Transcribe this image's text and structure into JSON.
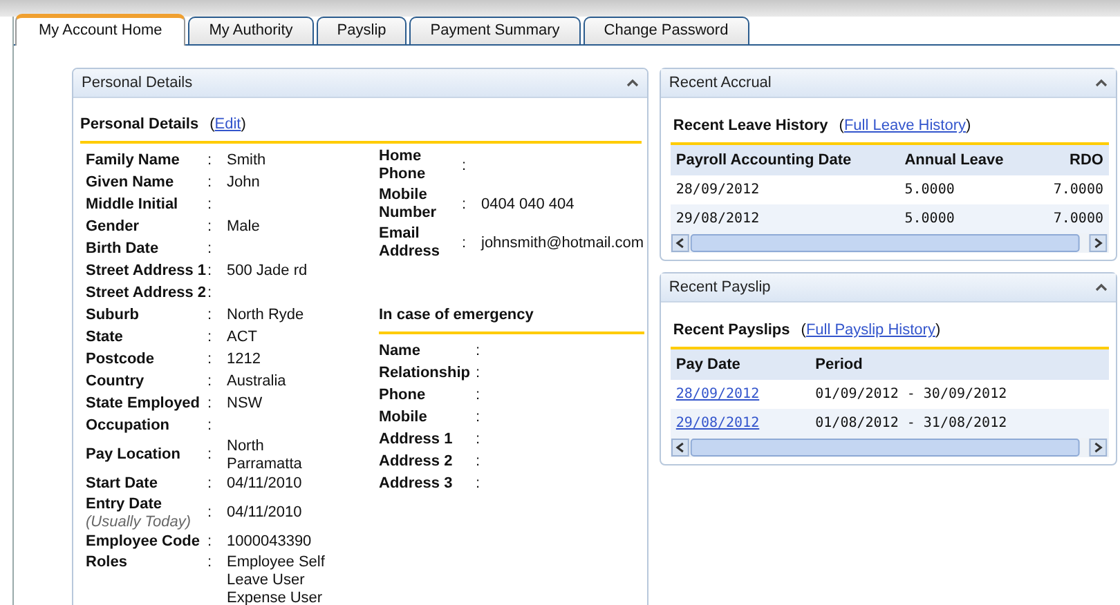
{
  "tabs": [
    {
      "label": "My Account Home",
      "selected": true
    },
    {
      "label": "My Authority",
      "selected": false
    },
    {
      "label": "Payslip",
      "selected": false
    },
    {
      "label": "Payment Summary",
      "selected": false
    },
    {
      "label": "Change Password",
      "selected": false
    }
  ],
  "personal_panel": {
    "title": "Personal Details",
    "heading": "Personal Details",
    "link_open": "(",
    "edit_link": "Edit",
    "link_close": ")",
    "fields": [
      {
        "label": "Family Name",
        "sep": ":",
        "value": "Smith"
      },
      {
        "label": "Given Name",
        "sep": ":",
        "value": "John"
      },
      {
        "label": "Middle Initial",
        "sep": ":"
      },
      {
        "label": "Gender",
        "sep": ":",
        "value": "Male"
      },
      {
        "label": "Birth Date",
        "sep": ":"
      },
      {
        "label": "Street Address 1",
        "sep": ":",
        "value": "500 Jade rd"
      },
      {
        "label": "Street Address 2",
        "sep": ":"
      },
      {
        "label": "Suburb",
        "sep": ":",
        "value": "North Ryde"
      },
      {
        "label": "State",
        "sep": ":",
        "value": "ACT"
      },
      {
        "label": "Postcode",
        "sep": ":",
        "value": "1212"
      },
      {
        "label": "Country",
        "sep": ":",
        "value": "Australia"
      },
      {
        "label": "State Employed",
        "sep": ":",
        "value": "NSW"
      },
      {
        "label": "Occupation",
        "sep": ":"
      },
      {
        "label": "Pay Location",
        "sep": ":",
        "value": "North Parramatta"
      },
      {
        "label": "Start Date",
        "sep": ":",
        "value": "04/11/2010"
      },
      {
        "label": "Entry Date",
        "hint": "(Usually Today)",
        "sep": ":",
        "value": "04/11/2010"
      },
      {
        "label": "Employee Code",
        "sep": ":",
        "value": "1000043390"
      },
      {
        "label": "Roles",
        "sep": ":",
        "values": [
          "Employee Self",
          "Leave User",
          "Expense User"
        ]
      }
    ],
    "contact": [
      {
        "label": "Home Phone",
        "sep": ":"
      },
      {
        "label": "Mobile Number",
        "sep": ":",
        "value": "0404 040 404"
      },
      {
        "label": "Email Address",
        "sep": ":",
        "value": "johnsmith@hotmail.com"
      }
    ],
    "emergency_heading": "In case of emergency",
    "emergency": [
      {
        "label": "Name",
        "sep": ":"
      },
      {
        "label": "Relationship",
        "sep": ":"
      },
      {
        "label": "Phone",
        "sep": ":"
      },
      {
        "label": "Mobile",
        "sep": ":"
      },
      {
        "label": "Address 1",
        "sep": ":"
      },
      {
        "label": "Address 2",
        "sep": ":"
      },
      {
        "label": "Address 3",
        "sep": ":"
      }
    ]
  },
  "accrual_panel": {
    "title": "Recent Accrual",
    "heading": "Recent Leave History",
    "link_open": "(",
    "link": "Full Leave History",
    "link_close": ")",
    "columns": [
      "Payroll Accounting Date",
      "Annual Leave",
      "RDO"
    ],
    "rows": [
      {
        "cells": [
          "28/09/2012",
          "5.0000",
          "7.0000"
        ]
      },
      {
        "cells": [
          "29/08/2012",
          "5.0000",
          "7.0000"
        ]
      }
    ]
  },
  "payslip_panel": {
    "title": "Recent Payslip",
    "heading": "Recent Payslips",
    "link_open": "(",
    "link": "Full Payslip History",
    "link_close": ")",
    "columns": [
      "Pay Date",
      "Period"
    ],
    "rows": [
      {
        "cells": [
          "28/09/2012",
          "01/09/2012 - 30/09/2012"
        ]
      },
      {
        "cells": [
          "29/08/2012",
          "01/08/2012 - 31/08/2012"
        ]
      }
    ]
  }
}
